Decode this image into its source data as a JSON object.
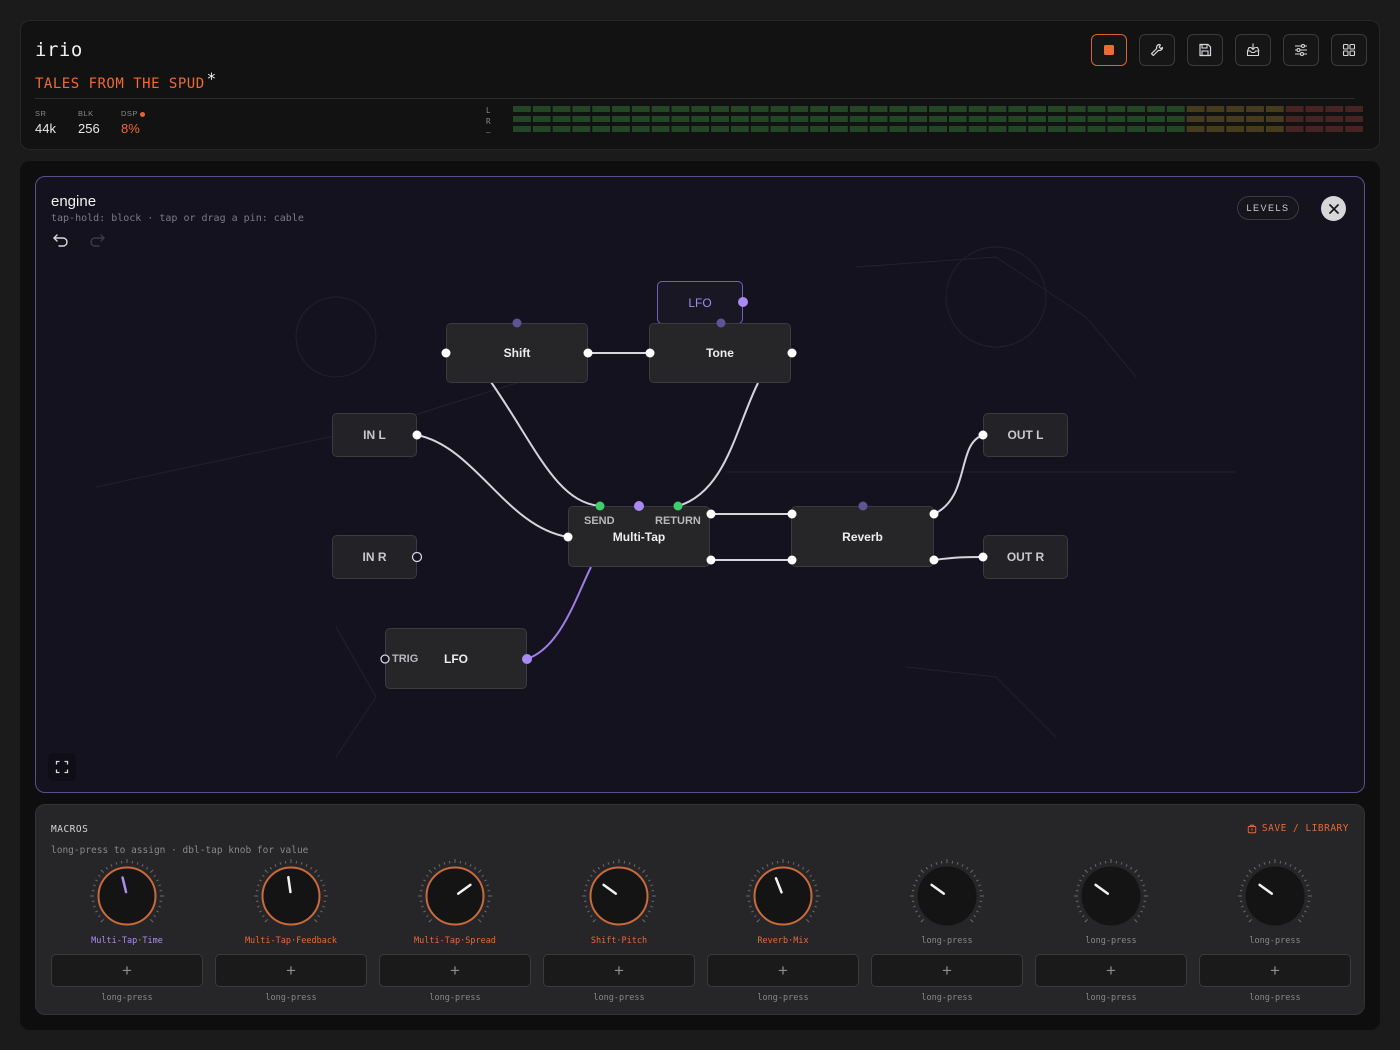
{
  "header": {
    "app_name": "irio",
    "project_name": "TALES FROM THE SPUD",
    "dirty_marker": "*",
    "stats": [
      {
        "label": "SR",
        "value": "44k"
      },
      {
        "label": "BLK",
        "value": "256"
      },
      {
        "label": "DSP",
        "value": "8%"
      }
    ],
    "meter_labels": [
      "L",
      "R",
      "—"
    ],
    "buttons": [
      {
        "name": "stop",
        "icon": "stop-icon"
      },
      {
        "name": "tools",
        "icon": "wrench-icon"
      },
      {
        "name": "save",
        "icon": "save-icon"
      },
      {
        "name": "import",
        "icon": "inbox-download-icon"
      },
      {
        "name": "settings",
        "icon": "sliders-icon"
      },
      {
        "name": "grid",
        "icon": "grid-icon"
      }
    ],
    "colors": {
      "accent": "#ee6b34",
      "meter_green": "#2a5a2e",
      "meter_amber": "#5a4a22",
      "meter_red": "#5a2a2a"
    }
  },
  "engine": {
    "title": "engine",
    "hint": "tap-hold: block · tap or drag a pin: cable",
    "levels_label": "LEVELS",
    "nodes": {
      "lfo_tag": "LFO",
      "shift": "Shift",
      "tone": "Tone",
      "in_l": "IN L",
      "in_r": "IN R",
      "multitap": "Multi-Tap",
      "send": "SEND",
      "return": "RETURN",
      "reverb": "Reverb",
      "out_l": "OUT L",
      "out_r": "OUT R",
      "lfo": "LFO",
      "trig": "TRIG"
    },
    "colors": {
      "border": "#59508a",
      "cable": "#d6d3dc",
      "lfo_cable": "#9b7ee6",
      "send_pin": "#3fcf6a"
    }
  },
  "macros": {
    "title": "MACROS",
    "hint": "long-press to assign · dbl-tap knob for value",
    "save_label": "SAVE / LIBRARY",
    "knobs": [
      {
        "label": "Multi-Tap·Time",
        "assigned": true,
        "color": "#a98ef0",
        "value": 0.45,
        "slot": "long-press"
      },
      {
        "label": "Multi-Tap·Feedback",
        "assigned": true,
        "color": "#e56a37",
        "value": 0.47,
        "slot": "long-press"
      },
      {
        "label": "Multi-Tap·Spread",
        "assigned": true,
        "color": "#e56a37",
        "value": 0.7,
        "slot": "long-press"
      },
      {
        "label": "Shift·Pitch",
        "assigned": true,
        "color": "#e56a37",
        "value": 0.3,
        "slot": "long-press"
      },
      {
        "label": "Reverb·Mix",
        "assigned": true,
        "color": "#e56a37",
        "value": 0.42,
        "slot": "long-press"
      },
      {
        "label": "long-press",
        "assigned": false,
        "color": "#88888b",
        "value": 0.3,
        "slot": "long-press"
      },
      {
        "label": "long-press",
        "assigned": false,
        "color": "#88888b",
        "value": 0.3,
        "slot": "long-press"
      },
      {
        "label": "long-press",
        "assigned": false,
        "color": "#88888b",
        "value": 0.3,
        "slot": "long-press"
      }
    ],
    "slot_plus": "+"
  }
}
